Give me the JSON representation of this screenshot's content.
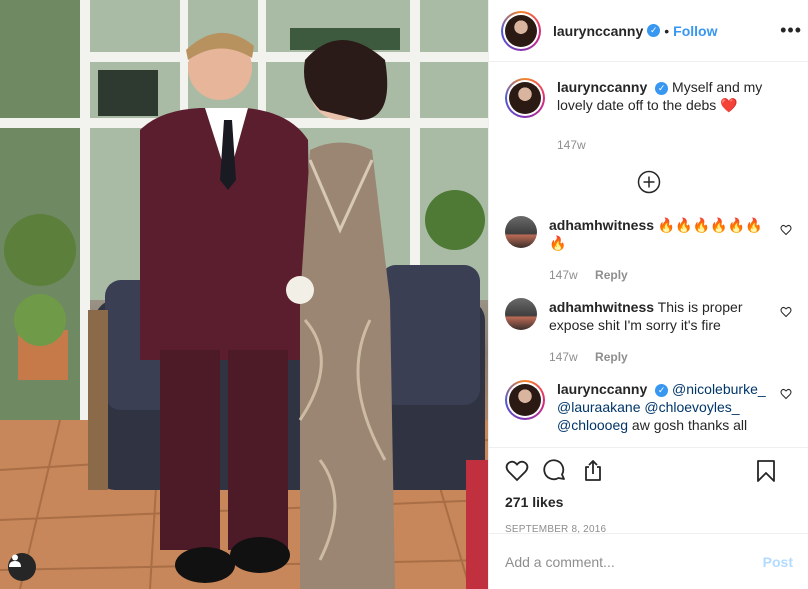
{
  "post": {
    "author": "laurynccanny",
    "follow_label": "Follow",
    "dot": "•",
    "caption": "Myself and my lovely date off to the debs",
    "caption_emoji": "❤️",
    "caption_age": "147w",
    "likes": "271 likes",
    "date": "September 8, 2016"
  },
  "comments": [
    {
      "username": "adhamhwitness",
      "text": "🔥🔥🔥🔥🔥🔥🔥",
      "age": "147w",
      "reply": "Reply"
    },
    {
      "username": "adhamhwitness",
      "text": "This is proper expose shit I'm sorry it's fire",
      "age": "147w",
      "reply": "Reply"
    },
    {
      "username": "laurynccanny",
      "mentions": "@nicoleburke_ @lauraakane @chloevoyles_ @chloooeg",
      "text": " aw gosh thanks all"
    }
  ],
  "composer": {
    "placeholder": "Add a comment...",
    "post_label": "Post"
  },
  "icons": [
    "heart-icon",
    "comment-icon",
    "share-icon",
    "bookmark-icon",
    "more-icon",
    "verified-icon",
    "load-more-icon",
    "user-tag-icon"
  ],
  "colors": {
    "link": "#3897f0",
    "muted": "#8e8e8e",
    "text": "#262626",
    "post_disabled": "#b3dbff",
    "emoji_heart": "#ed4956"
  }
}
